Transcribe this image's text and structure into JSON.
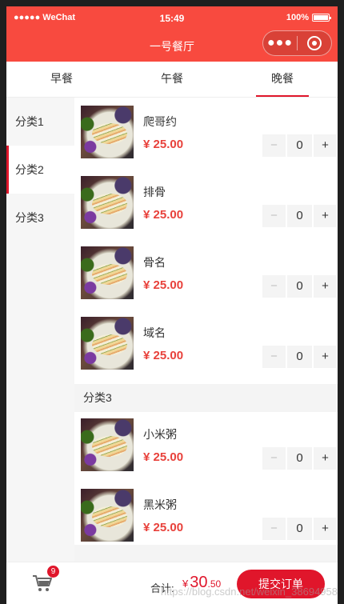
{
  "status_bar": {
    "carrier": "●●●●● WeChat",
    "time": "15:49",
    "battery": "100%"
  },
  "nav": {
    "title": "一号餐厅",
    "menu_icon": "more-dots-icon",
    "close_icon": "target-close-icon"
  },
  "tabs": [
    {
      "label": "早餐",
      "active": false
    },
    {
      "label": "午餐",
      "active": false
    },
    {
      "label": "晚餐",
      "active": true
    }
  ],
  "side_menu": [
    {
      "label": "分类1",
      "active": false
    },
    {
      "label": "分类2",
      "active": true
    },
    {
      "label": "分类3",
      "active": false
    }
  ],
  "foods": [
    {
      "name": "爬哥约",
      "price": "¥ 25.00",
      "qty": "0",
      "minus": "−",
      "plus": "+"
    },
    {
      "name": "排骨",
      "price": "¥ 25.00",
      "qty": "0",
      "minus": "−",
      "plus": "+"
    },
    {
      "name": "骨名",
      "price": "¥ 25.00",
      "qty": "0",
      "minus": "−",
      "plus": "+"
    },
    {
      "name": "域名",
      "price": "¥ 25.00",
      "qty": "0",
      "minus": "−",
      "plus": "+"
    },
    {
      "name": "小米粥",
      "price": "¥ 25.00",
      "qty": "0",
      "minus": "−",
      "plus": "+"
    },
    {
      "name": "黑米粥",
      "price": "¥ 25.00",
      "qty": "0",
      "minus": "−",
      "plus": "+"
    }
  ],
  "category_header": "分类3",
  "bottom": {
    "cart_icon": "cart-icon",
    "badge": "9",
    "total_label": "合计:",
    "currency": "¥",
    "total_int": "30",
    "total_dec": ".50",
    "submit_label": "提交订单",
    "watermark": "https://blog.csdn.net/weixin_38694958"
  },
  "colors": {
    "theme": "#f84a3f",
    "accent": "#e0162b",
    "price": "#e8413b"
  }
}
